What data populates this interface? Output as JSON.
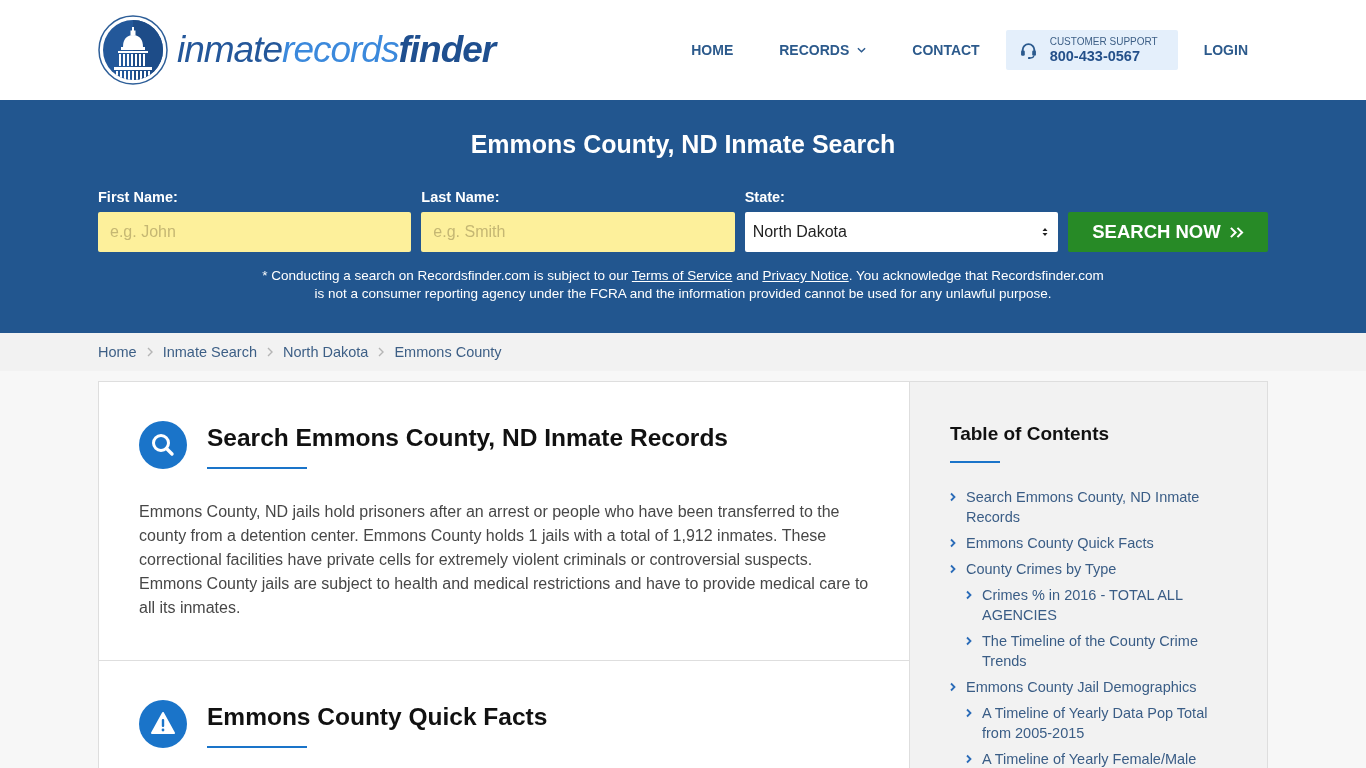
{
  "header": {
    "logo": [
      {
        "kind": "dark",
        "text": "inmate"
      },
      {
        "kind": "light",
        "text": "records"
      },
      {
        "kind": "bold",
        "text": "finder"
      }
    ],
    "nav": [
      {
        "kind": "link",
        "label": "HOME"
      },
      {
        "kind": "dropdown",
        "label": "RECORDS"
      },
      {
        "kind": "link",
        "label": "CONTACT"
      },
      {
        "kind": "support",
        "caption": "CUSTOMER SUPPORT",
        "phone": "800-433-0567"
      },
      {
        "kind": "link",
        "label": "LOGIN"
      }
    ]
  },
  "search_banner": {
    "title": "Emmons County, ND Inmate Search",
    "fields": [
      {
        "kind": "text",
        "label": "First Name:",
        "placeholder": "e.g. John"
      },
      {
        "kind": "text",
        "label": "Last Name:",
        "placeholder": "e.g. Smith"
      },
      {
        "kind": "select",
        "label": "State:",
        "value": "North Dakota"
      }
    ],
    "button": "SEARCH NOW",
    "disclaimer": [
      {
        "kind": "text",
        "text": "* Conducting a search on Recordsfinder.com is subject to our "
      },
      {
        "kind": "link",
        "text": "Terms of Service"
      },
      {
        "kind": "text",
        "text": " and "
      },
      {
        "kind": "link",
        "text": "Privacy Notice"
      },
      {
        "kind": "text",
        "text": ". You acknowledge that Recordsfinder.com is not a consumer reporting agency under the FCRA and the information provided cannot be used for any unlawful purpose."
      }
    ]
  },
  "breadcrumb": [
    "Home",
    "Inmate Search",
    "North Dakota",
    "Emmons County"
  ],
  "sections": [
    {
      "kind": "search",
      "title": "Search Emmons County, ND Inmate Records",
      "paragraphs": [
        "Emmons County, ND jails hold prisoners after an arrest or people who have been transferred to the county from a detention center. Emmons County holds 1 jails with a total of 1,912 inmates. These correctional facilities have private cells for extremely violent criminals or controversial suspects. Emmons County jails are subject to health and medical restrictions and have to provide medical care to all its inmates."
      ]
    },
    {
      "kind": "alert",
      "title": "Emmons County Quick Facts"
    }
  ],
  "table_of_contents": {
    "title": "Table of Contents",
    "items": [
      {
        "label": "Search Emmons County, ND Inmate Records"
      },
      {
        "label": "Emmons County Quick Facts"
      },
      {
        "label": "County Crimes by Type",
        "children": [
          {
            "label": "Crimes % in 2016 - TOTAL ALL AGENCIES"
          },
          {
            "label": "The Timeline of the County Crime Trends"
          }
        ]
      },
      {
        "label": "Emmons County Jail Demographics",
        "children": [
          {
            "label": "A Timeline of Yearly Data Pop Total from 2005-2015"
          },
          {
            "label": "A Timeline of Yearly Female/Male"
          }
        ]
      }
    ]
  }
}
